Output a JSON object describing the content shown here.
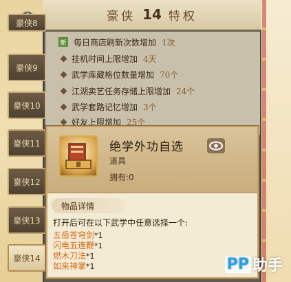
{
  "header": {
    "title_left": "豪侠",
    "title_level": "14",
    "title_right": "特权"
  },
  "tabs": [
    {
      "label": "豪侠8"
    },
    {
      "label": "豪侠9"
    },
    {
      "label": "豪侠10"
    },
    {
      "label": "豪侠11"
    },
    {
      "label": "豪侠12"
    },
    {
      "label": "豪侠13"
    },
    {
      "label": "豪侠14"
    }
  ],
  "perks": [
    {
      "text": "每日商店刷新次数增加",
      "value": "1次",
      "icon": "new"
    },
    {
      "text": "挂机时间上限增加",
      "value": "4天",
      "icon": "diamond"
    },
    {
      "text": "武学库藏格位数量增加",
      "value": "70个",
      "icon": "diamond"
    },
    {
      "text": "江湖卖艺任务存储上限增加",
      "value": "24个",
      "icon": "diamond"
    },
    {
      "text": "武学套路记忆增加",
      "value": "3个",
      "icon": "diamond"
    },
    {
      "text": "好友上限增加",
      "value": "25个",
      "icon": "diamond"
    }
  ],
  "popup": {
    "item_name": "绝学外功自选",
    "item_type": "道具",
    "owned_label": "拥有:0",
    "detail_tab": "物品详情",
    "description": "打开后可在以下武学中任意选择一个:",
    "choices": [
      {
        "name": "五岳苍穹剑",
        "count": "*1"
      },
      {
        "name": "闪电五连鞭",
        "count": "*1"
      },
      {
        "name": "燃木刀法",
        "count": "*1"
      },
      {
        "name": "如来神掌",
        "count": "*1"
      }
    ]
  },
  "watermark": {
    "brand": "PP",
    "suffix": "助手"
  },
  "colors": {
    "accent": "#d36a1c",
    "panel": "#f4ebd4",
    "frame": "#caa46a"
  }
}
